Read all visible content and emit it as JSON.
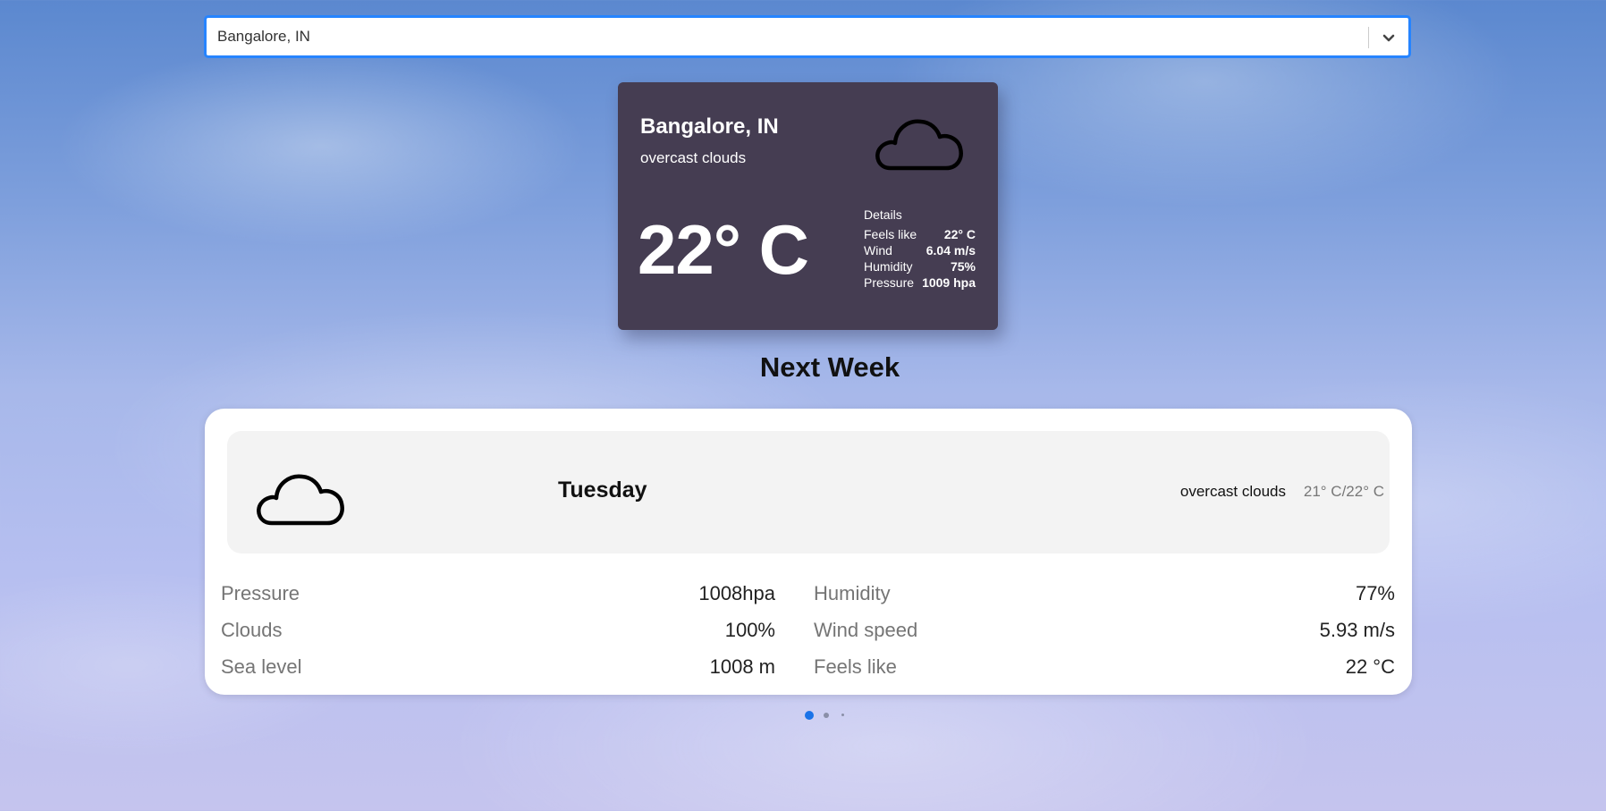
{
  "search": {
    "value": "Bangalore, IN"
  },
  "current": {
    "city": "Bangalore, IN",
    "description": "overcast clouds",
    "icon": "cloud-icon",
    "temperature": "22° C",
    "details": {
      "title": "Details",
      "rows": [
        {
          "label": "Feels like",
          "value": "22° C"
        },
        {
          "label": "Wind",
          "value": "6.04 m/s"
        },
        {
          "label": "Humidity",
          "value": "75%"
        },
        {
          "label": "Pressure",
          "value": "1009 hpa"
        }
      ]
    }
  },
  "forecast": {
    "heading": "Next Week",
    "day": {
      "icon": "cloud-icon",
      "name": "Tuesday",
      "description": "overcast clouds",
      "range": "21° C/22° C"
    },
    "left": [
      {
        "label": "Pressure",
        "value": "1008hpa"
      },
      {
        "label": "Clouds",
        "value": "100%"
      },
      {
        "label": "Sea level",
        "value": "1008 m"
      }
    ],
    "right": [
      {
        "label": "Humidity",
        "value": "77%"
      },
      {
        "label": "Wind speed",
        "value": "5.93 m/s"
      },
      {
        "label": "Feels like",
        "value": "22 °C"
      }
    ]
  },
  "carousel": {
    "active_color": "#1a73e8",
    "inactive_color": "#8a8fa8"
  }
}
